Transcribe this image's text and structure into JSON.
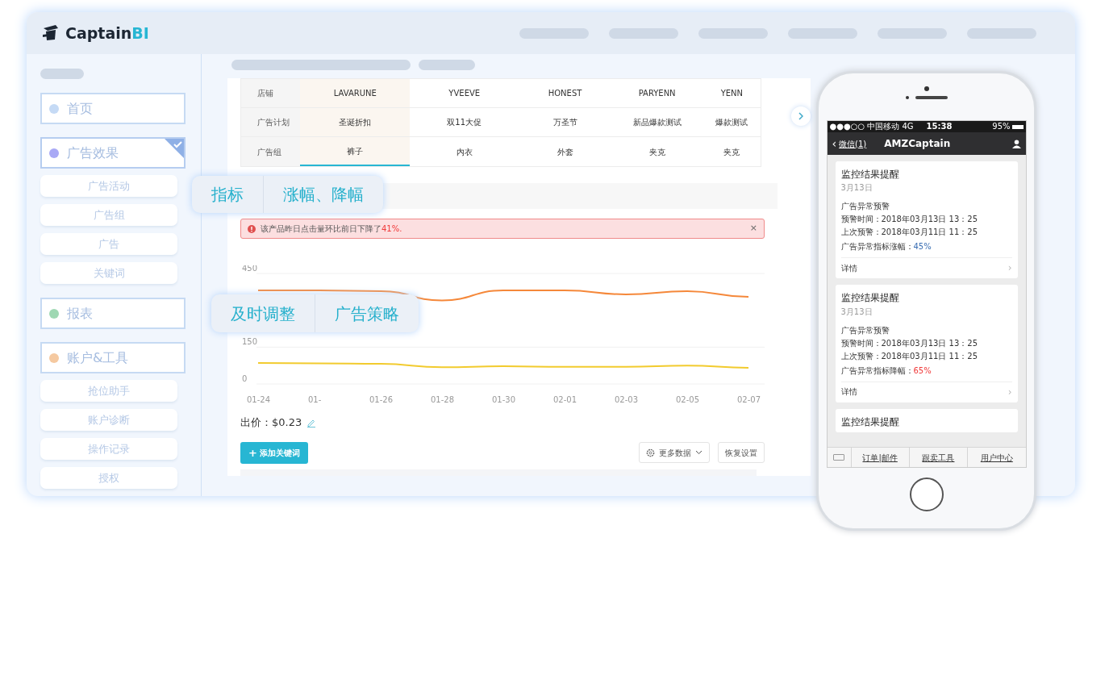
{
  "app": {
    "logo_main": "Captain",
    "logo_accent": "BI"
  },
  "sidebar": {
    "items": [
      {
        "kind": "section",
        "label": "首页",
        "color": "#c5daf5",
        "selected": false
      },
      {
        "kind": "section",
        "label": "广告效果",
        "color": "#a9a9f5",
        "selected": true
      },
      {
        "kind": "sub",
        "label": "广告活动"
      },
      {
        "kind": "sub",
        "label": "广告组"
      },
      {
        "kind": "sub",
        "label": "广告"
      },
      {
        "kind": "sub",
        "label": "关键词"
      },
      {
        "kind": "section",
        "label": "报表",
        "color": "#9fd8b3",
        "selected": false
      },
      {
        "kind": "section",
        "label": "账户&工具",
        "color": "#f5c9a0",
        "selected": false
      },
      {
        "kind": "sub",
        "label": "抢位助手"
      },
      {
        "kind": "sub",
        "label": "账户诊断"
      },
      {
        "kind": "sub",
        "label": "操作记录"
      },
      {
        "kind": "sub",
        "label": "授权"
      }
    ]
  },
  "table": {
    "rows": [
      {
        "header": "店铺",
        "cells": [
          {
            "text": "LAVARUNE",
            "selected": true
          },
          {
            "text": "YVEEVE",
            "selected": false
          },
          {
            "text": "HONEST",
            "selected": false
          },
          {
            "text": "PARYENN",
            "selected": false
          },
          {
            "text": "YENN",
            "selected": false
          }
        ]
      },
      {
        "header": "广告计划",
        "cells": [
          {
            "text": "圣诞折扣",
            "selected": true
          },
          {
            "text": "双11大促",
            "selected": false
          },
          {
            "text": "万圣节",
            "selected": false
          },
          {
            "text": "新品爆款测试",
            "selected": false
          },
          {
            "text": "爆款测试",
            "selected": false
          }
        ]
      },
      {
        "header": "广告组",
        "cells": [
          {
            "text": "裤子",
            "selected": true
          },
          {
            "text": "内衣",
            "selected": false
          },
          {
            "text": "外套",
            "selected": false
          },
          {
            "text": "夹克",
            "selected": false
          },
          {
            "text": "夹克",
            "selected": false
          }
        ]
      }
    ]
  },
  "callouts": [
    {
      "parts": [
        "指标",
        "涨幅、降幅"
      ]
    },
    {
      "parts": [
        "及时调整",
        "广告策略"
      ]
    }
  ],
  "alert": {
    "text": "该产品昨日点击量环比前日下降了",
    "highlight": "41%.",
    "close": "×"
  },
  "chart_data": {
    "type": "line",
    "categories": [
      "01-24",
      "01-",
      "01-26",
      "01-28",
      "01-30",
      "02-01",
      "02-03",
      "02-05",
      "02-07"
    ],
    "series": [
      {
        "color": "#f5883a",
        "values": [
          381,
          381,
          378,
          340,
          381,
          381,
          365,
          378,
          355
        ]
      },
      {
        "color": "#f2cb2e",
        "values": [
          85,
          84,
          82,
          68,
          72,
          70,
          70,
          75,
          66
        ]
      }
    ],
    "ylim": [
      0,
      450
    ],
    "yticks": [
      0,
      150,
      450
    ]
  },
  "bid": {
    "label": "出价：$0.23"
  },
  "toolbar": {
    "add_icon": "+",
    "add_button": "添加关键词",
    "more_button": "更多数据",
    "reset_button": "恢复设置"
  },
  "phone": {
    "status": {
      "carrier": "●●●○○ 中国移动  4G",
      "time": "15:38",
      "battery": "95%"
    },
    "nav": {
      "back_icon": "‹",
      "back": "微信(1)",
      "title": "AMZCaptain"
    },
    "cards": [
      {
        "title": "监控结果提醒",
        "date": "3月13日",
        "lines": [
          "广告异常预警",
          "预警时间：2018年03月13日 13：25",
          "上次预警：2018年03月11日 11：25"
        ],
        "metric_label": "广告异常指标涨幅：",
        "metric_value": "45%",
        "color": "#3b6fb3",
        "link": "详情",
        "link_icon": "›"
      },
      {
        "title": "监控结果提醒",
        "date": "3月13日",
        "lines": [
          "广告异常预警",
          "预警时间：2018年03月13日 13：25",
          "上次预警：2018年03月11日 11：25"
        ],
        "metric_label": "广告异常指标降幅：",
        "metric_value": "65%",
        "color": "#f03a3a",
        "link": "详情",
        "link_icon": "›"
      },
      {
        "title": "监控结果提醒"
      }
    ],
    "menu": [
      "订单|邮件",
      "跟卖工具",
      "用户中心"
    ]
  }
}
